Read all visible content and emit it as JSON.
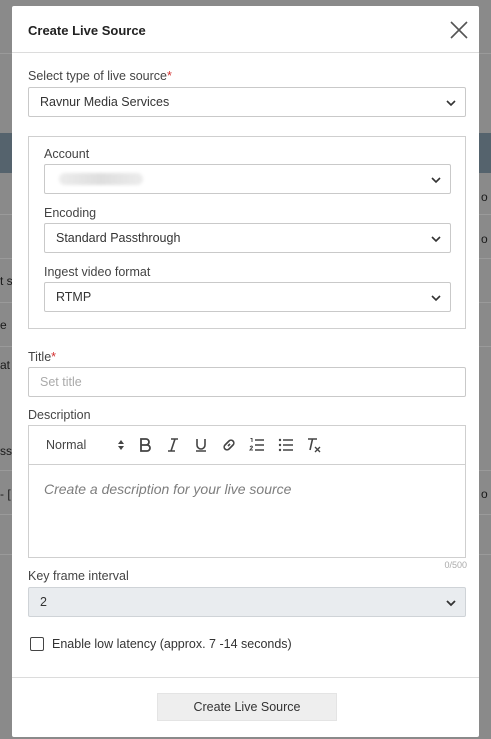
{
  "modal": {
    "title": "Create Live Source"
  },
  "source_type": {
    "label": "Select type of live source",
    "required_mark": "*",
    "value": "Ravnur Media Services"
  },
  "account": {
    "label": "Account"
  },
  "encoding": {
    "label": "Encoding",
    "value": "Standard Passthrough"
  },
  "ingest_format": {
    "label": "Ingest video format",
    "value": "RTMP"
  },
  "title_field": {
    "label": "Title",
    "required_mark": "*",
    "placeholder": "Set title"
  },
  "description": {
    "label": "Description",
    "format_value": "Normal",
    "placeholder": "Create a description for your live source",
    "counter": "0/500"
  },
  "key_frame": {
    "label": "Key frame interval",
    "value": "2"
  },
  "low_latency": {
    "label": "Enable low latency (approx. 7 -14 seconds)",
    "checked": false
  },
  "submit": {
    "label": "Create Live Source"
  },
  "background_fragments": {
    "f1": "o",
    "f2": "o",
    "f3": "t s",
    "f4": "e",
    "f5": "at",
    "f6": "ss",
    "f7": "- [",
    "f8": "o"
  },
  "colors": {
    "required": "#d32f2f",
    "gray_select": "#e9ecef",
    "button_bg": "#eeeeee"
  }
}
